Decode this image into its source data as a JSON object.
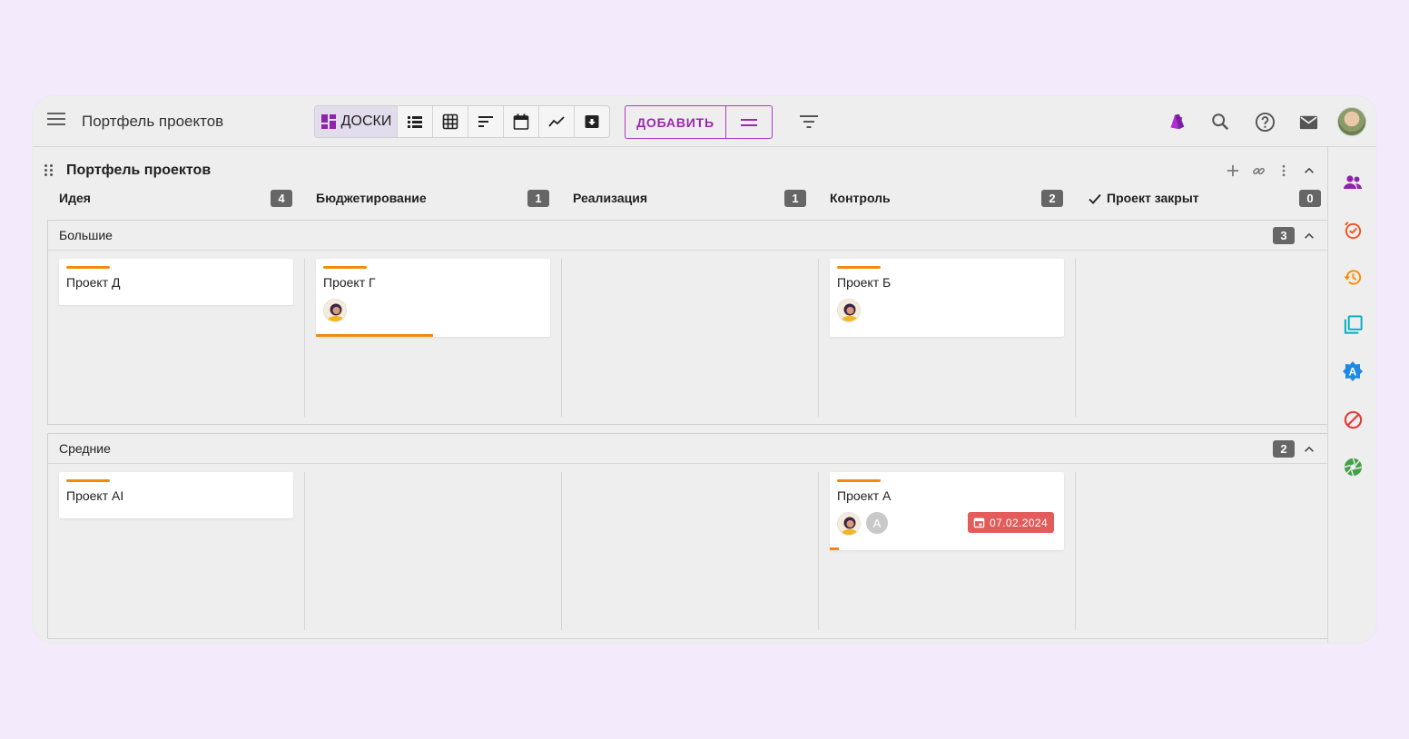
{
  "app": {
    "title": "Портфель проектов"
  },
  "toolbar": {
    "views": {
      "boards_label": "ДОСКИ"
    },
    "add_label": "ДОБАВИТЬ"
  },
  "board": {
    "title": "Портфель проектов",
    "columns": [
      {
        "name": "Идея",
        "count": "4"
      },
      {
        "name": "Бюджетирование",
        "count": "1"
      },
      {
        "name": "Реализация",
        "count": "1"
      },
      {
        "name": "Контроль",
        "count": "2"
      },
      {
        "name": "Проект закрыт",
        "count": "0",
        "icon": "check-icon"
      }
    ],
    "groups": [
      {
        "name": "Большие",
        "count": "3",
        "cards": [
          {
            "title": "Проект Д"
          },
          {
            "title": "Проект Г",
            "progress": 0.5
          },
          {
            "title": "Проект Б"
          }
        ]
      },
      {
        "name": "Средние",
        "count": "2",
        "cards": [
          {
            "title": "Проект AI"
          },
          {
            "title": "Проект А",
            "initial": "A",
            "due": "07.02.2024",
            "progress": 0.04
          }
        ]
      }
    ]
  },
  "colors": {
    "accent": "#9c27b0",
    "stripe": "#f28a0f",
    "due_badge": "#e35c5c",
    "count_badge": "#666666",
    "background": "#f3eafc"
  }
}
